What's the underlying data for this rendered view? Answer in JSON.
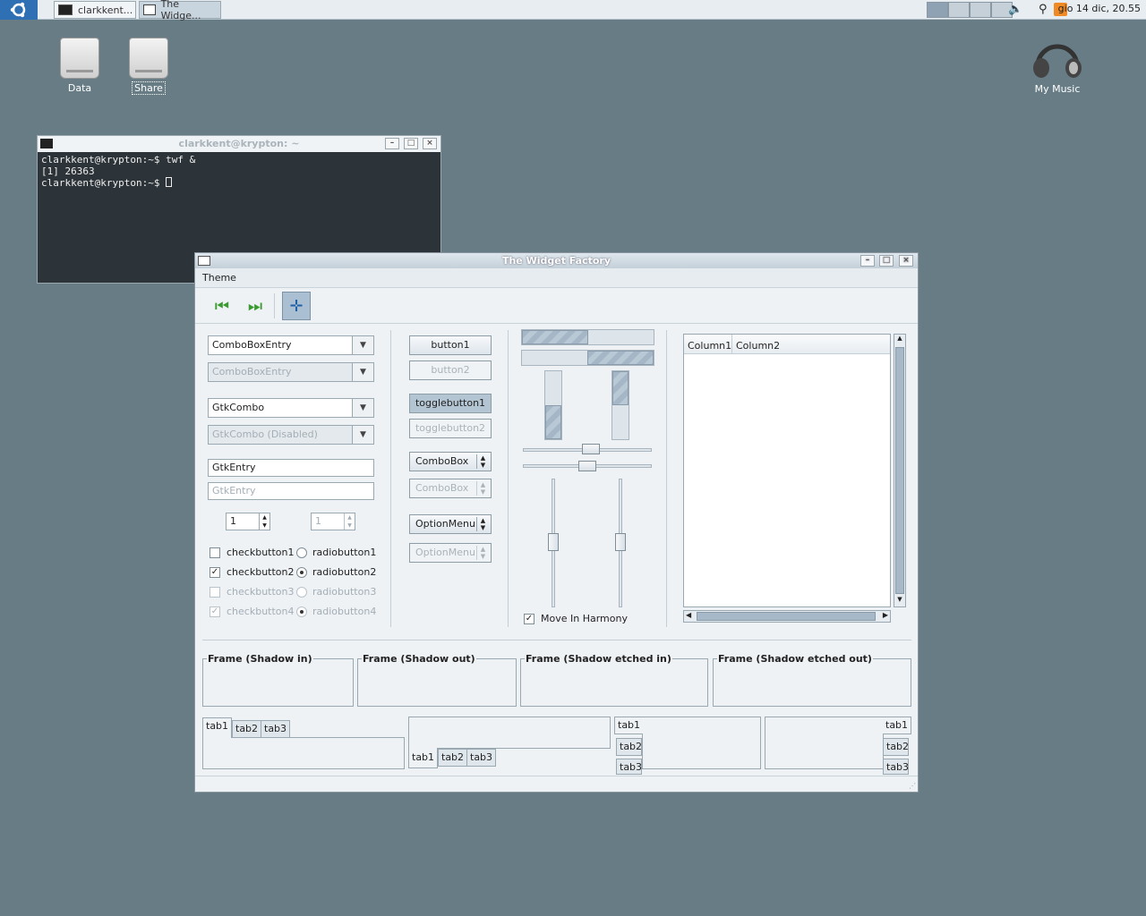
{
  "panel": {
    "tasks": [
      {
        "label": "clarkkent..."
      },
      {
        "label": "The Widge..."
      }
    ],
    "clock": "gio 14 dic, 20.55"
  },
  "desktop": {
    "icons": [
      {
        "label": "Data"
      },
      {
        "label": "Share"
      },
      {
        "label": "My Music"
      }
    ]
  },
  "terminal": {
    "title": "clarkkent@krypton: ~",
    "lines": [
      "clarkkent@krypton:~$ twf &",
      "[1] 26363",
      "clarkkent@krypton:~$ "
    ]
  },
  "window": {
    "title": "The Widget Factory",
    "menu": {
      "theme": "Theme"
    },
    "col1": {
      "combo_entry": "ComboBoxEntry",
      "combo_entry_dis": "ComboBoxEntry",
      "gtk_combo": "GtkCombo",
      "gtk_combo_dis": "GtkCombo (Disabled)",
      "entry": "GtkEntry",
      "entry_dis": "GtkEntry",
      "spin": "1",
      "spin_dis": "1",
      "checks": [
        "checkbutton1",
        "checkbutton2",
        "checkbutton3",
        "checkbutton4"
      ],
      "radios": [
        "radiobutton1",
        "radiobutton2",
        "radiobutton3",
        "radiobutton4"
      ]
    },
    "col2": {
      "button1": "button1",
      "button2": "button2",
      "toggle1": "togglebutton1",
      "toggle2": "togglebutton2",
      "combobox": "ComboBox",
      "combobox_dis": "ComboBox",
      "option": "OptionMenu",
      "option_dis": "OptionMenu"
    },
    "col3": {
      "harmony": "Move In Harmony"
    },
    "tree": {
      "col1": "Column1",
      "col2": "Column2"
    },
    "frames": [
      "Frame (Shadow in)",
      "Frame (Shadow out)",
      "Frame (Shadow etched in)",
      "Frame (Shadow etched out)"
    ],
    "tabs": [
      "tab1",
      "tab2",
      "tab3"
    ]
  }
}
